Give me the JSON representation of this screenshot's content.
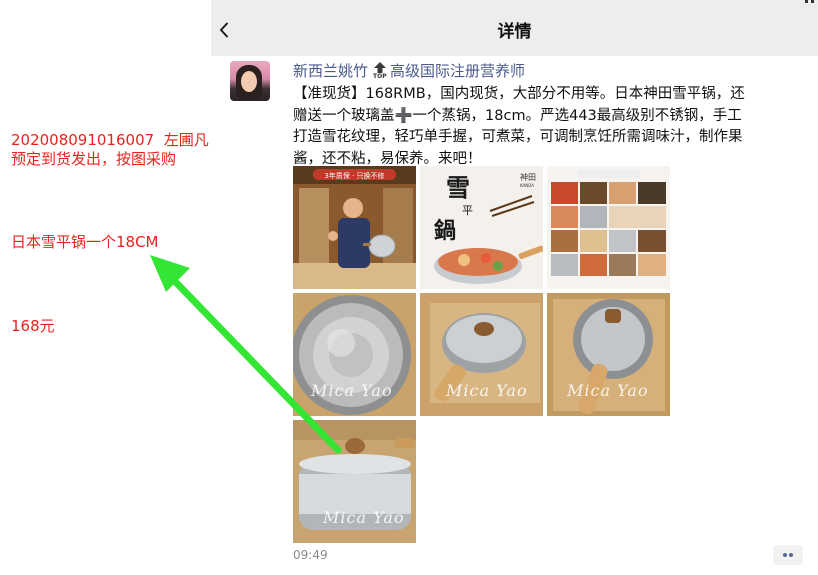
{
  "annotations": {
    "order_line1": "202008091016007  左圃凡",
    "order_line2": "预定到货发出，按图采购",
    "item": "日本雪平锅一个18CM",
    "price": "168元"
  },
  "nav": {
    "title": "详情",
    "back_icon": "chevron-left-icon"
  },
  "post": {
    "author": "新西兰姚竹",
    "badge_icon": "top-badge-icon",
    "badge_label": "TOP",
    "author_title": "高级国际注册营养师",
    "text": "【准现货】168RMB，国内现货，大部分不用等。日本神田雪平锅，还赠送一个玻璃盖➕一个蒸锅，18cm。严选443最高级别不锈钢，手工打造雪花纹理，轻巧单手握，可煮菜，可调制烹饪所需调味汁，制作果酱，还不粘，易保养。来吧！",
    "photo2_title": "雪平鍋",
    "photo2_brand": "神田",
    "photo2_brand_en": "KANDA",
    "photo1_banner": "3年质保 · 只换不修",
    "watermark": "Mica Yao",
    "time": "09:49",
    "more_icon": "more-dots-icon"
  },
  "colors": {
    "annotation_red": "#e8231f",
    "author_blue": "#4a5a8e",
    "arrow_green": "#33e633",
    "screen_bg": "#ededed"
  }
}
